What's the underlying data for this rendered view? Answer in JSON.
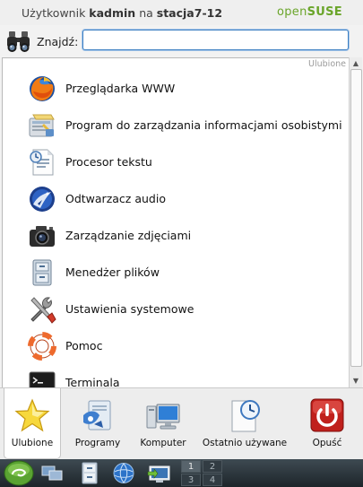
{
  "header": {
    "user_prefix": "Użytkownik",
    "username": "kadmin",
    "host_prefix": "na",
    "hostname": "stacja7-12",
    "brand_open": "open",
    "brand_suse": "SUSE"
  },
  "search": {
    "label": "Znajdź:",
    "value": "",
    "placeholder": ""
  },
  "section": {
    "label": "Ulubione"
  },
  "apps": [
    {
      "label": "Przeglądarka WWW",
      "icon": "firefox-icon"
    },
    {
      "label": "Program do zarządzania informacjami osobistymi",
      "icon": "pim-icon"
    },
    {
      "label": "Procesor tekstu",
      "icon": "word-processor-icon"
    },
    {
      "label": "Odtwarzacz audio",
      "icon": "audio-player-icon"
    },
    {
      "label": "Zarządzanie zdjęciami",
      "icon": "camera-icon"
    },
    {
      "label": "Menedżer plików",
      "icon": "file-manager-icon"
    },
    {
      "label": "Ustawienia systemowe",
      "icon": "tools-icon"
    },
    {
      "label": "Pomoc",
      "icon": "lifebuoy-icon"
    },
    {
      "label": "Terminala",
      "icon": "terminal-icon"
    }
  ],
  "tabs": [
    {
      "label": "Ulubione",
      "icon": "star-icon",
      "active": true
    },
    {
      "label": "Programy",
      "icon": "applications-icon",
      "active": false
    },
    {
      "label": "Komputer",
      "icon": "computer-icon",
      "active": false
    },
    {
      "label": "Ostatnio używane",
      "icon": "recent-icon",
      "active": false
    },
    {
      "label": "Opuść",
      "icon": "power-icon",
      "active": false
    }
  ],
  "taskbar": {
    "pager": [
      "1",
      "2",
      "3",
      "4"
    ],
    "active_desktop": "1"
  },
  "colors": {
    "brand_green": "#6aa52a",
    "focus_blue": "#3d7fc2",
    "power_red": "#c0201c"
  }
}
